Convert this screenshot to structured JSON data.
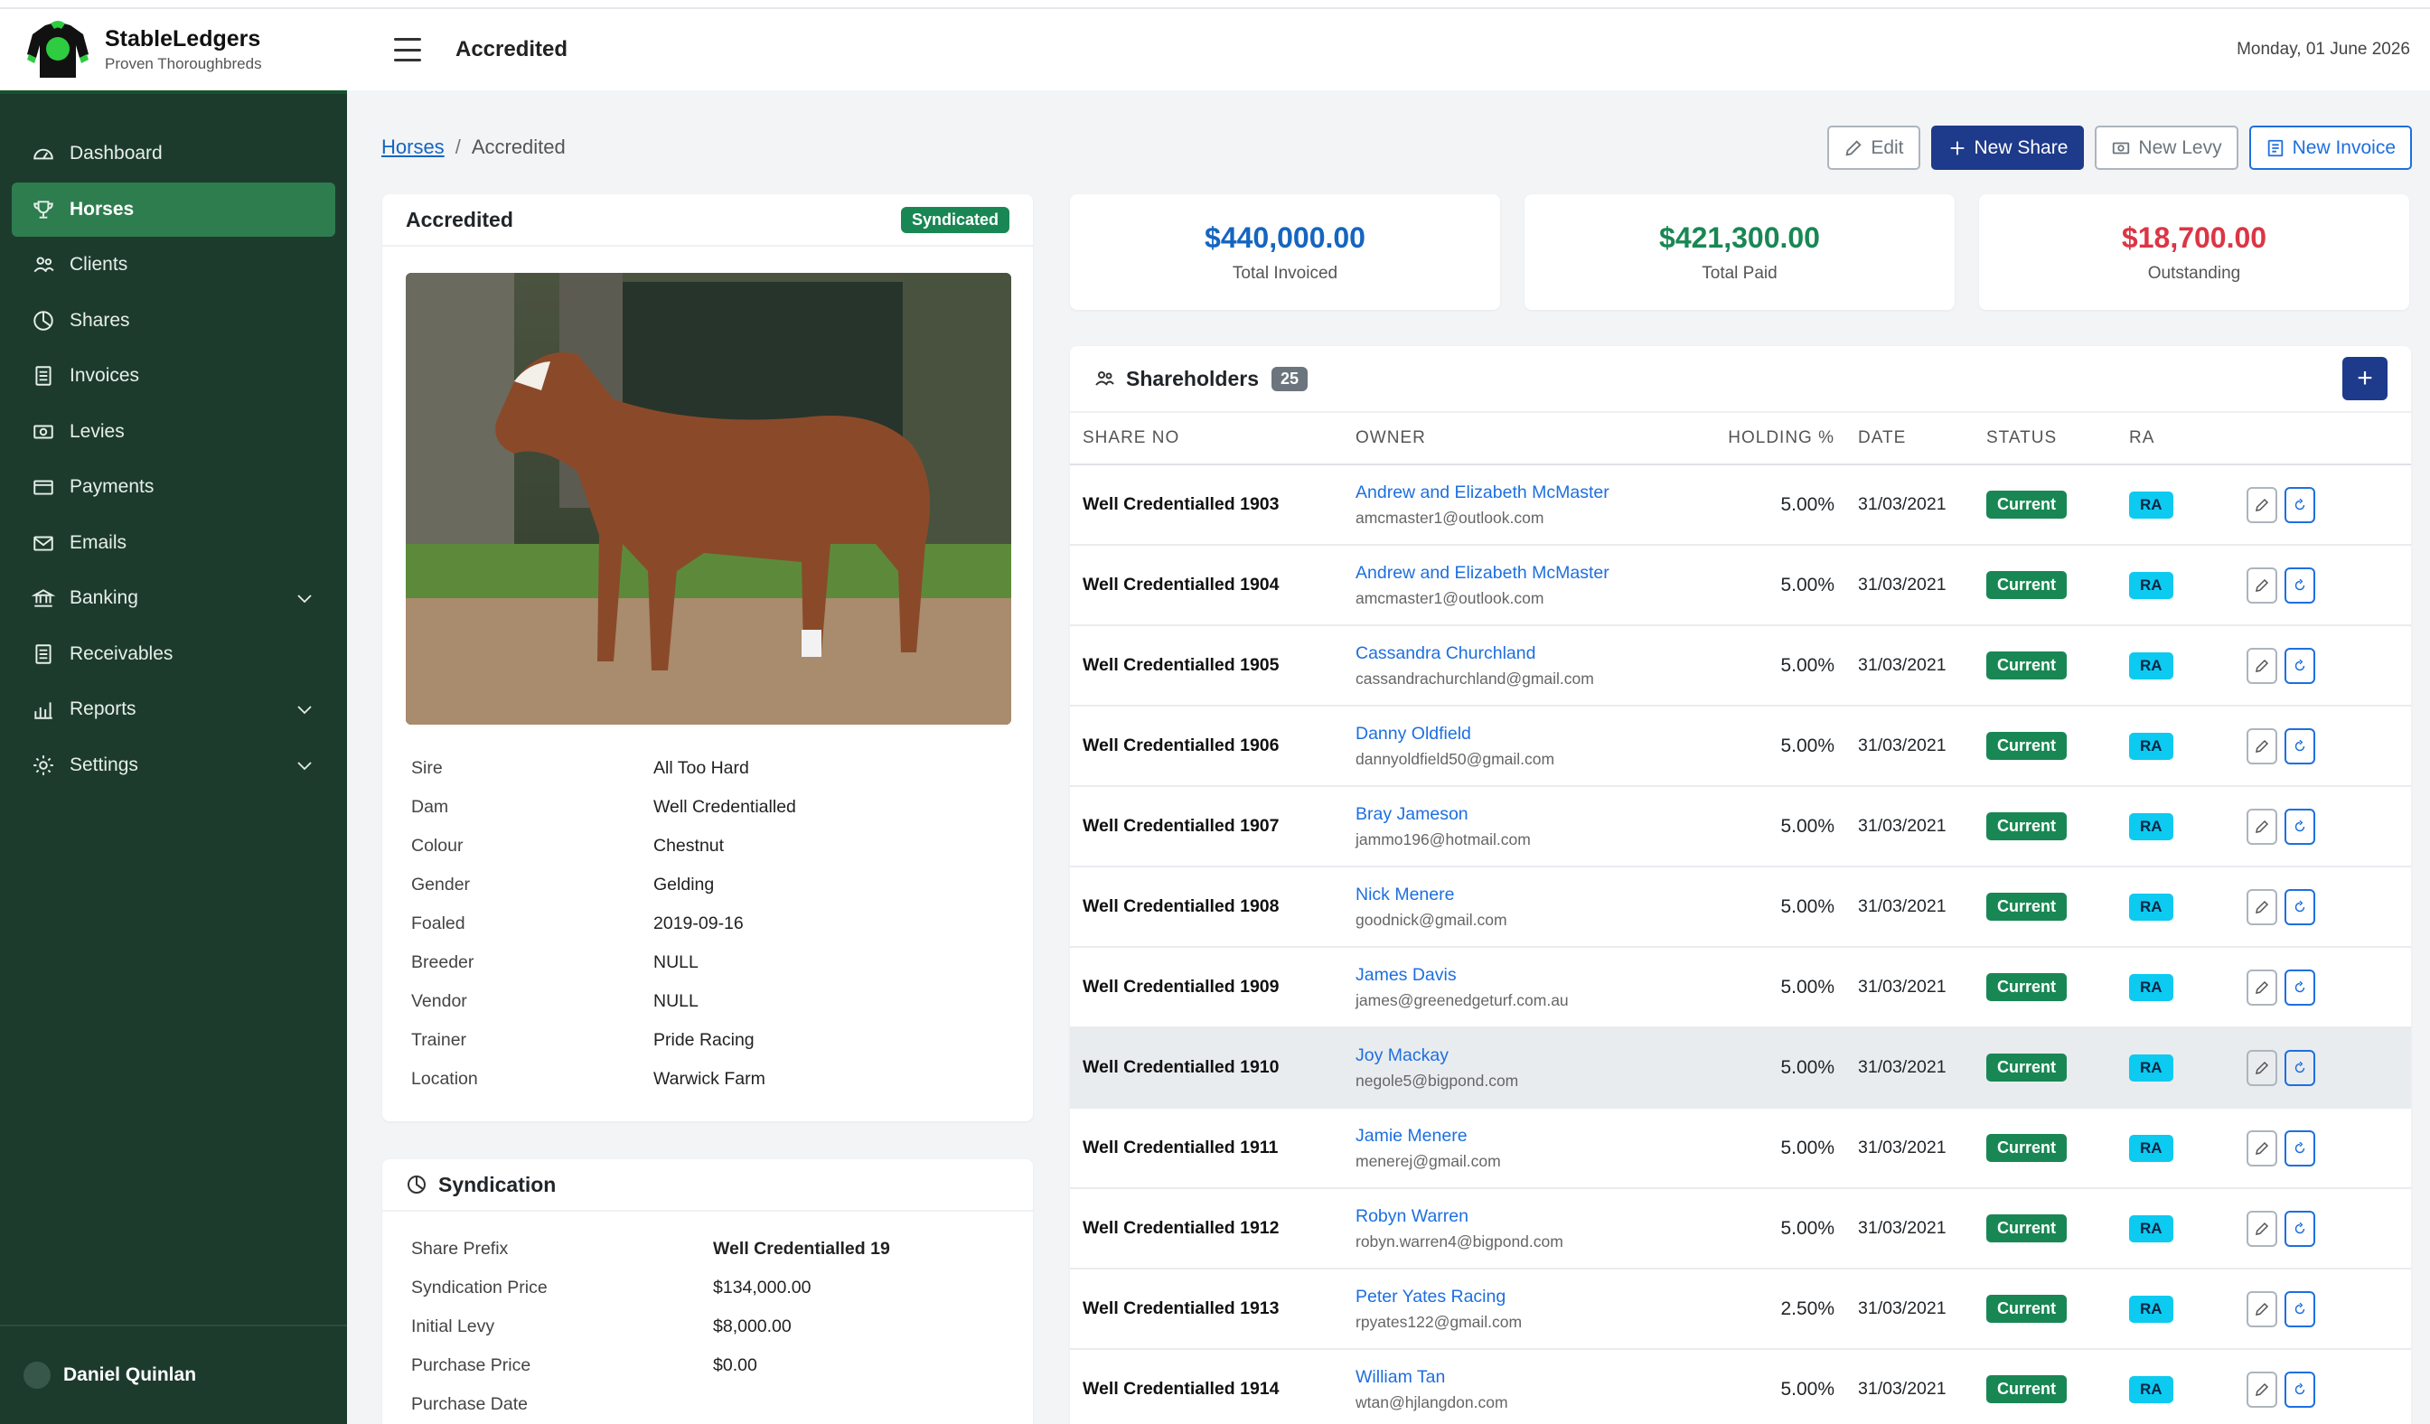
{
  "brand": {
    "name": "StableLedgers",
    "tagline": "Proven Thoroughbreds"
  },
  "header": {
    "title": "Accredited",
    "date": "Monday, 01 June 2026"
  },
  "sidebar": {
    "items": [
      {
        "label": "Dashboard",
        "icon": "dashboard-icon"
      },
      {
        "label": "Horses",
        "icon": "trophy-icon",
        "active": true
      },
      {
        "label": "Clients",
        "icon": "people-icon"
      },
      {
        "label": "Shares",
        "icon": "pie-chart-icon"
      },
      {
        "label": "Invoices",
        "icon": "document-icon"
      },
      {
        "label": "Levies",
        "icon": "cash-icon"
      },
      {
        "label": "Payments",
        "icon": "card-icon"
      },
      {
        "label": "Emails",
        "icon": "envelope-icon"
      },
      {
        "label": "Banking",
        "icon": "bank-icon",
        "expandable": true
      },
      {
        "label": "Receivables",
        "icon": "list-icon"
      },
      {
        "label": "Reports",
        "icon": "bar-chart-icon",
        "expandable": true
      },
      {
        "label": "Settings",
        "icon": "gear-icon",
        "expandable": true
      }
    ],
    "user": "Daniel Quinlan"
  },
  "breadcrumb": {
    "parent": "Horses",
    "current": "Accredited"
  },
  "actions": {
    "edit": "Edit",
    "new_share": "New Share",
    "new_levy": "New Levy",
    "new_invoice": "New Invoice"
  },
  "horse": {
    "name": "Accredited",
    "status": "Syndicated",
    "details": [
      {
        "label": "Sire",
        "value": "All Too Hard"
      },
      {
        "label": "Dam",
        "value": "Well Credentialled"
      },
      {
        "label": "Colour",
        "value": "Chestnut"
      },
      {
        "label": "Gender",
        "value": "Gelding"
      },
      {
        "label": "Foaled",
        "value": "2019-09-16"
      },
      {
        "label": "Breeder",
        "value": "NULL"
      },
      {
        "label": "Vendor",
        "value": "NULL"
      },
      {
        "label": "Trainer",
        "value": "Pride Racing"
      },
      {
        "label": "Location",
        "value": "Warwick Farm"
      }
    ]
  },
  "syndication": {
    "title": "Syndication",
    "rows": [
      {
        "label": "Share Prefix",
        "value": "Well Credentialled 19",
        "bold": true
      },
      {
        "label": "Syndication Price",
        "value": "$134,000.00"
      },
      {
        "label": "Initial Levy",
        "value": "$8,000.00"
      },
      {
        "label": "Purchase Price",
        "value": "$0.00"
      },
      {
        "label": "Purchase Date",
        "value": ""
      }
    ]
  },
  "stats": [
    {
      "amount": "$440,000.00",
      "label": "Total Invoiced",
      "color": "#1565c0"
    },
    {
      "amount": "$421,300.00",
      "label": "Total Paid",
      "color": "#198754"
    },
    {
      "amount": "$18,700.00",
      "label": "Outstanding",
      "color": "#dc3545"
    }
  ],
  "shareholders": {
    "title": "Shareholders",
    "count": "25",
    "columns": [
      "SHARE NO",
      "OWNER",
      "HOLDING %",
      "DATE",
      "STATUS",
      "RA"
    ],
    "rows": [
      {
        "share_no": "Well Credentialled 1903",
        "owner": "Andrew and Elizabeth McMaster",
        "email": "amcmaster1@outlook.com",
        "holding": "5.00%",
        "date": "31/03/2021",
        "status": "Current",
        "ra": "RA"
      },
      {
        "share_no": "Well Credentialled 1904",
        "owner": "Andrew and Elizabeth McMaster",
        "email": "amcmaster1@outlook.com",
        "holding": "5.00%",
        "date": "31/03/2021",
        "status": "Current",
        "ra": "RA"
      },
      {
        "share_no": "Well Credentialled 1905",
        "owner": "Cassandra Churchland",
        "email": "cassandrachurchland@gmail.com",
        "holding": "5.00%",
        "date": "31/03/2021",
        "status": "Current",
        "ra": "RA"
      },
      {
        "share_no": "Well Credentialled 1906",
        "owner": "Danny Oldfield",
        "email": "dannyoldfield50@gmail.com",
        "holding": "5.00%",
        "date": "31/03/2021",
        "status": "Current",
        "ra": "RA"
      },
      {
        "share_no": "Well Credentialled 1907",
        "owner": "Bray Jameson",
        "email": "jammo196@hotmail.com",
        "holding": "5.00%",
        "date": "31/03/2021",
        "status": "Current",
        "ra": "RA"
      },
      {
        "share_no": "Well Credentialled 1908",
        "owner": "Nick Menere",
        "email": "goodnick@gmail.com",
        "holding": "5.00%",
        "date": "31/03/2021",
        "status": "Current",
        "ra": "RA"
      },
      {
        "share_no": "Well Credentialled 1909",
        "owner": "James Davis",
        "email": "james@greenedgeturf.com.au",
        "holding": "5.00%",
        "date": "31/03/2021",
        "status": "Current",
        "ra": "RA"
      },
      {
        "share_no": "Well Credentialled 1910",
        "owner": "Joy Mackay",
        "email": "negole5@bigpond.com",
        "holding": "5.00%",
        "date": "31/03/2021",
        "status": "Current",
        "ra": "RA",
        "highlight": true
      },
      {
        "share_no": "Well Credentialled 1911",
        "owner": "Jamie Menere",
        "email": "menerej@gmail.com",
        "holding": "5.00%",
        "date": "31/03/2021",
        "status": "Current",
        "ra": "RA"
      },
      {
        "share_no": "Well Credentialled 1912",
        "owner": "Robyn Warren",
        "email": "robyn.warren4@bigpond.com",
        "holding": "5.00%",
        "date": "31/03/2021",
        "status": "Current",
        "ra": "RA"
      },
      {
        "share_no": "Well Credentialled 1913",
        "owner": "Peter Yates Racing",
        "email": "rpyates122@gmail.com",
        "holding": "2.50%",
        "date": "31/03/2021",
        "status": "Current",
        "ra": "RA"
      },
      {
        "share_no": "Well Credentialled 1914",
        "owner": "William Tan",
        "email": "wtan@hjlangdon.com",
        "holding": "5.00%",
        "date": "31/03/2021",
        "status": "Current",
        "ra": "RA"
      }
    ]
  }
}
